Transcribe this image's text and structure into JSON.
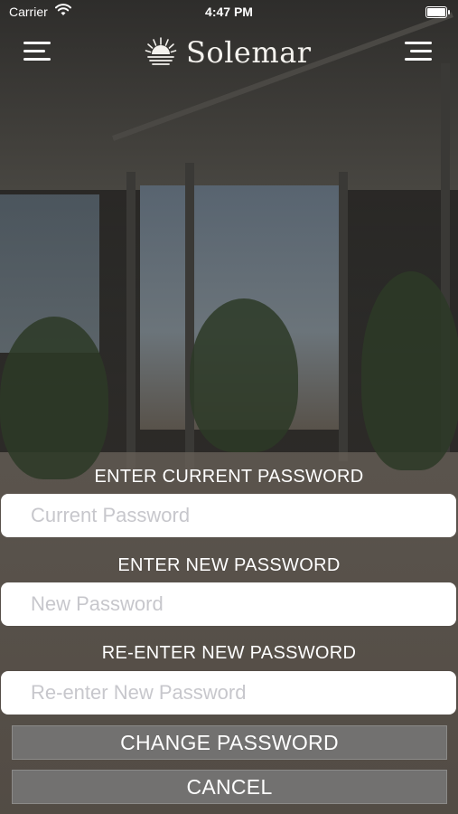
{
  "status_bar": {
    "carrier": "Carrier",
    "time": "4:47 PM"
  },
  "header": {
    "brand": "Solemar",
    "left_icon": "hamburger-menu-icon",
    "right_icon": "hamburger-menu-icon"
  },
  "form": {
    "current": {
      "label": "ENTER CURRENT PASSWORD",
      "placeholder": "Current Password",
      "value": ""
    },
    "new": {
      "label": "ENTER NEW PASSWORD",
      "placeholder": "New Password",
      "value": ""
    },
    "confirm": {
      "label": "RE-ENTER NEW PASSWORD",
      "placeholder": "Re-enter New Password",
      "value": ""
    }
  },
  "buttons": {
    "change": "CHANGE PASSWORD",
    "cancel": "CANCEL"
  },
  "colors": {
    "button_bg": "#727170",
    "field_bg": "#ffffff",
    "placeholder": "#c7c7cc",
    "text": "#ffffff"
  }
}
